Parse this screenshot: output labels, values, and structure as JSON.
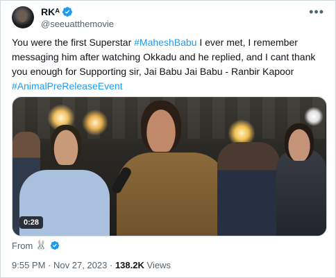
{
  "tweet": {
    "author_name": "RKᴬ",
    "author_handle": "@seeuatthemovie",
    "more_icon": "more-horizontal-icon",
    "text_lines": [
      [
        {
          "t": "You were the first Superstar ",
          "h": false
        },
        {
          "t": "#MaheshBabu",
          "h": true
        },
        {
          "t": " I ever met, I remember",
          "h": false
        }
      ],
      [
        {
          "t": "messaging him after watching Okkadu and he replied, and I cant thank",
          "h": false
        }
      ],
      [
        {
          "t": "you enough for Supporting sir, Jai Babu Jai Babu - Ranbir Kapoor",
          "h": false
        }
      ],
      [
        {
          "t": "#AnimalPreReleaseEvent",
          "h": true
        }
      ]
    ],
    "video_duration": "0:28",
    "from_label": "From",
    "from_emoji": "🐰",
    "time": "9:55 PM",
    "dot": "·",
    "date": "Nov 27, 2023",
    "views_count": "138.2K",
    "views_label": "Views"
  },
  "colors": {
    "link": "#1d9bf0",
    "verified": "#1d9bf0",
    "secondary_text": "#536471",
    "primary_text": "#0f1419"
  }
}
